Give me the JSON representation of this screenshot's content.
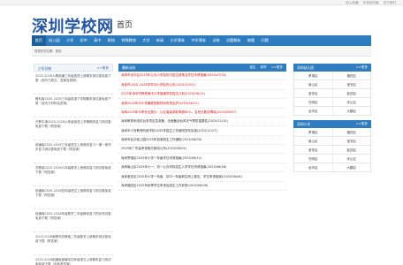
{
  "top": {
    "links": [
      "加入收藏",
      "手机访问版",
      "关于我们"
    ]
  },
  "brand": {
    "logo": "深圳学校网",
    "home": "首页"
  },
  "nav": {
    "items": [
      "首页",
      "幼儿园",
      "小学",
      "初中",
      "高中",
      "职校",
      "特殊教育",
      "大学",
      "新闻",
      "小学课本",
      "中学课本",
      "试卷",
      "试题解析",
      "做题",
      "问题"
    ]
  },
  "breadcrumb": {
    "text": "您现在的位置：首页"
  },
  "left": {
    "title": "小学试卷",
    "more": ">>更多",
    "items": [
      "2025-2026人教部编三年级英语上册期末测试卷免费下载（含听力原文、答案及音频）",
      "教科版2025-2026三年级英语下学期期末测试卷免费下载（含听力材料及答案）",
      "沪教牛津2025-2026六年级英语上学期期末复习测试卷免费下载（附答案）",
      "统编版2025-2026三年级语文上册期末复习一课一练同步复习测试卷免费下载（附答案）",
      "苏教版2025-2026六年级数学上册期末复习测试卷免费下载（附答案）",
      "统编版2025-2026四年级语文上册期末复习测试卷免费下载（附答案）",
      "统编版2025-2026年级数学二年级期末复习同步测试卷免费下载（附答案）",
      "2025-2026新教材苏教版二年级数学上册期末测试卷免费下载（附答案）",
      "2025-2026统编版部编本四年级语文上册期末复习测试卷免费下载（含参考答案）"
    ]
  },
  "mid": {
    "title": "最新动态",
    "tabs": [
      "招生",
      "转学",
      ">>更多"
    ],
    "items": [
      {
        "text": "深圳市龙华区2025年公办小学及初中招生政策及学位申请指南(2025/07/02)",
        "red": true
      },
      {
        "text": "深圳市2025-2026学年中小学校历公布(2025/07/01)",
        "red": true
      },
      {
        "text": "2025年深圳市教育局中小学普通学校招生计划(2025/06/13)",
        "red": true
      },
      {
        "text": "深圳2025年中小学暑假放假时间安排出炉(2025/06/11)",
        "red": true
      },
      {
        "text": "深圳2025年中考安全提示：公办普高录取率超60%，名校分数线揭晓(2025/06/07)",
        "red": true
      },
      {
        "text": "深圳教育系统抗台多项应急准备，全面备战台风天气预防重要性(2025/12/10)",
        "red": false
      },
      {
        "text": "深圳市义务教育阶段学校2025年招生工作细则发布实施(2025/11/27)",
        "red": false
      },
      {
        "text": "深圳市民办幼儿园2025年招收新生工作通知(2025/06/05)",
        "red": false
      },
      {
        "text": "2025年广东高考录取分数线公布(2025/06/25)",
        "red": false
      },
      {
        "text": "深圳罗湖区2025年小学一年级学位申请指南(2025/06/11)",
        "red": false
      },
      {
        "text": "深圳南山区2025年小一、初一公办学校招生入学学位申请指南(2025/06/06)",
        "red": false
      },
      {
        "text": "深圳宝安区2025年小学一年级、初中一年级新生网上报名、学位申请指南(2025/06/06)",
        "red": false
      },
      {
        "text": "深圳福田区2025年秋季学位申请及招生工作安排(2025/06/06)",
        "red": false
      }
    ]
  },
  "right": {
    "kinder": {
      "title": "深圳幼儿园",
      "more": ">>更多",
      "rows": [
        [
          "罗湖区",
          "福田区"
        ],
        [
          "南山区",
          "宝安区"
        ],
        [
          "宝安区",
          "盐田区"
        ],
        [
          "光明区",
          "坪山区"
        ],
        [
          "龙华区",
          "大鹏区"
        ]
      ]
    },
    "primary": {
      "title": "深圳小学",
      "more": ">>更多",
      "rows": [
        [
          "罗湖区",
          "福田区"
        ],
        [
          "南山区",
          "宝安区"
        ],
        [
          "宝安区",
          "盐田区"
        ],
        [
          "光明区",
          "坪山区"
        ],
        [
          "龙华区",
          "大鹏区"
        ]
      ]
    }
  }
}
